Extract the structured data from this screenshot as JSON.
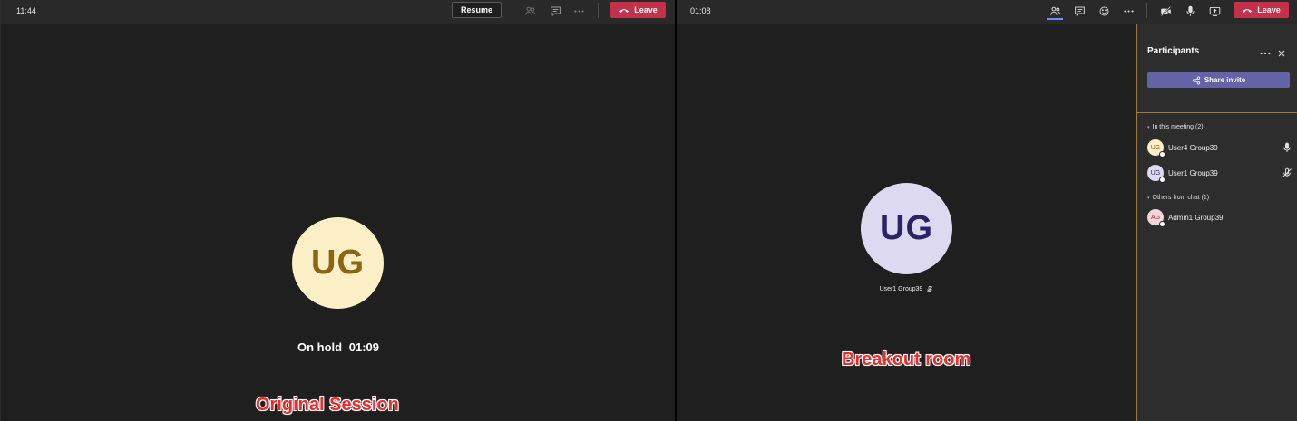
{
  "left_window": {
    "clock": "11:44",
    "resume_label": "Resume",
    "leave_label": "Leave",
    "avatar_initials": "UG",
    "hold_status": "On hold",
    "hold_time": "01:09",
    "caption": "Original Session"
  },
  "right_window": {
    "clock": "01:08",
    "leave_label": "Leave",
    "avatar_initials": "UG",
    "video_name": "User1 Group39",
    "caption": "Breakout room"
  },
  "participants": {
    "title": "Participants",
    "share_label": "Share invite",
    "in_meeting_label": "In this meeting (2)",
    "others_label": "Others from chat (1)",
    "in_meeting": [
      {
        "initials": "UG",
        "name": "User4 Group39",
        "mic": "mic-on"
      },
      {
        "initials": "UG",
        "name": "User1 Group39",
        "mic": "mic-off"
      }
    ],
    "others": [
      {
        "initials": "AG",
        "name": "Admin1 Group39"
      }
    ]
  },
  "colors": {
    "leave": "#c4314b",
    "share": "#6264a7",
    "avatar_yellow": "#fdefc6",
    "avatar_lavender": "#dcd9f0",
    "avatar_pink": "#f2d6d8"
  }
}
